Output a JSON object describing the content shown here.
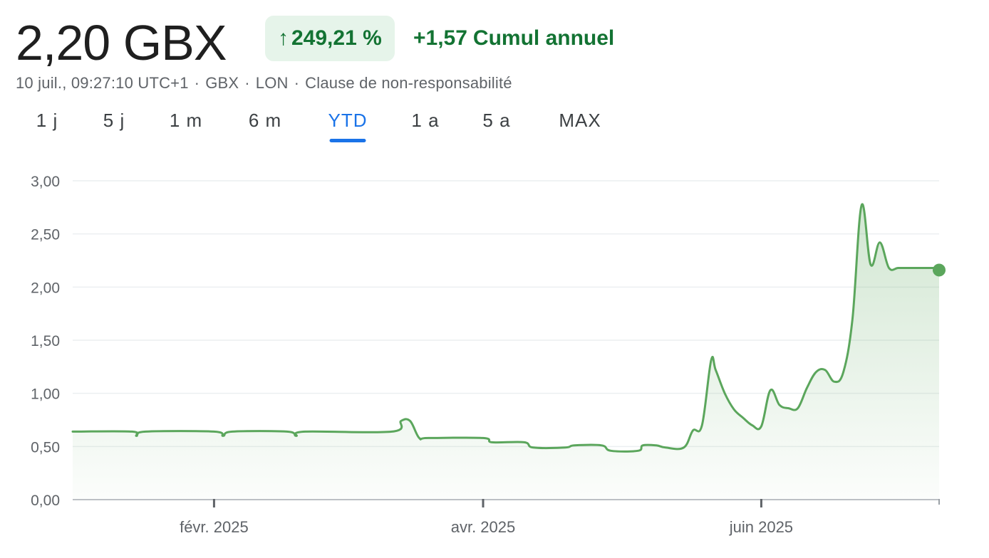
{
  "header": {
    "price": "2,20 GBX",
    "change_percent": "249,21 %",
    "change_arrow": "↑",
    "change_abs": "+1,57",
    "change_period": "Cumul annuel"
  },
  "meta": {
    "timestamp": "10 juil., 09:27:10 UTC+1",
    "currency": "GBX",
    "exchange": "LON",
    "disclaimer": "Clause de non-responsabilité"
  },
  "tabs": [
    {
      "label": "1 j",
      "active": false
    },
    {
      "label": "5 j",
      "active": false
    },
    {
      "label": "1 m",
      "active": false
    },
    {
      "label": "6 m",
      "active": false
    },
    {
      "label": "YTD",
      "active": true
    },
    {
      "label": "1 a",
      "active": false
    },
    {
      "label": "5 a",
      "active": false
    },
    {
      "label": "MAX",
      "active": false
    }
  ],
  "colors": {
    "line": "#5ba65c",
    "accent_tab": "#1a73e8",
    "positive": "#137333",
    "badge_bg": "#e6f4ea"
  },
  "chart_data": {
    "type": "area",
    "title": "",
    "xlabel": "",
    "ylabel": "",
    "ylim": [
      0,
      3
    ],
    "xlim": [
      "2025-01-01",
      "2025-07-10"
    ],
    "grid": true,
    "y_ticks": [
      "0,00",
      "0,50",
      "1,00",
      "1,50",
      "2,00",
      "2,50",
      "3,00"
    ],
    "y_tick_values": [
      0,
      0.5,
      1,
      1.5,
      2,
      2.5,
      3
    ],
    "x_ticks": [
      {
        "date": "2025-02-01",
        "label": "févr. 2025"
      },
      {
        "date": "2025-04-01",
        "label": "avr. 2025"
      },
      {
        "date": "2025-06-01",
        "label": "juin 2025"
      }
    ],
    "x_minor_ticks": [
      "2025-07-10"
    ],
    "series": [
      {
        "name": "",
        "x": [
          "2025-01-01",
          "2025-01-14",
          "2025-01-15",
          "2025-01-17",
          "2025-02-01",
          "2025-02-03",
          "2025-02-05",
          "2025-02-17",
          "2025-02-19",
          "2025-02-21",
          "2025-03-12",
          "2025-03-14",
          "2025-03-16",
          "2025-03-18",
          "2025-03-20",
          "2025-04-01",
          "2025-04-03",
          "2025-04-10",
          "2025-04-12",
          "2025-04-19",
          "2025-04-21",
          "2025-04-27",
          "2025-04-29",
          "2025-05-05",
          "2025-05-06",
          "2025-05-09",
          "2025-05-11",
          "2025-05-15",
          "2025-05-17",
          "2025-05-19",
          "2025-05-21",
          "2025-05-22",
          "2025-05-24",
          "2025-05-26",
          "2025-05-28",
          "2025-05-30",
          "2025-06-01",
          "2025-06-03",
          "2025-06-05",
          "2025-06-07",
          "2025-06-09",
          "2025-06-11",
          "2025-06-13",
          "2025-06-15",
          "2025-06-17",
          "2025-06-19",
          "2025-06-21",
          "2025-06-23",
          "2025-06-25",
          "2025-06-27",
          "2025-06-29",
          "2025-07-01",
          "2025-07-03",
          "2025-07-05",
          "2025-07-07",
          "2025-07-09",
          "2025-07-10"
        ],
        "y": [
          0.64,
          0.64,
          0.6,
          0.64,
          0.64,
          0.6,
          0.64,
          0.64,
          0.6,
          0.64,
          0.64,
          0.74,
          0.74,
          0.58,
          0.58,
          0.58,
          0.54,
          0.54,
          0.49,
          0.49,
          0.51,
          0.51,
          0.46,
          0.46,
          0.51,
          0.51,
          0.49,
          0.49,
          0.65,
          0.7,
          1.31,
          1.22,
          1.0,
          0.85,
          0.77,
          0.7,
          0.69,
          1.03,
          0.89,
          0.86,
          0.86,
          1.05,
          1.2,
          1.22,
          1.11,
          1.2,
          1.7,
          2.77,
          2.21,
          2.42,
          2.18,
          2.18,
          2.18,
          2.18,
          2.18,
          2.18,
          2.18
        ]
      }
    ],
    "last_value": 2.16
  }
}
